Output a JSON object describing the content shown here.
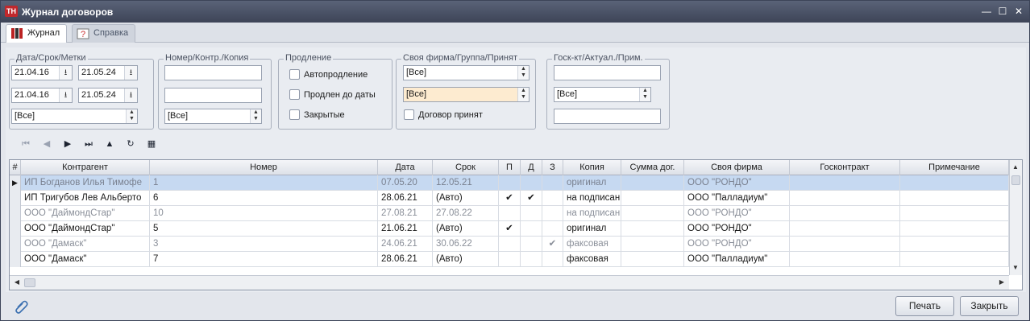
{
  "window": {
    "title": "Журнал договоров",
    "app_icon": "ТН",
    "minimize": "—",
    "maximize": "☐",
    "close": "✕"
  },
  "tabs": [
    {
      "label": "Журнал",
      "icon": "journal-icon"
    },
    {
      "label": "Справка",
      "icon": "help-icon"
    }
  ],
  "filters": {
    "dates": {
      "title": "Дата/Срок/Метки",
      "date_from1": "21.04.16",
      "date_to1": "21.05.24",
      "date_from2": "21.04.16",
      "date_to2": "21.05.24",
      "marks": "[Все]"
    },
    "number": {
      "title": "Номер/Контр./Копия",
      "number": "",
      "contractor": "",
      "copy": "[Все]"
    },
    "renewal": {
      "title": "Продление",
      "auto": "Автопродление",
      "extended": "Продлен до даты",
      "closed": "Закрытые"
    },
    "company": {
      "title": "Своя фирма/Группа/Принят",
      "firm": "[Все]",
      "group": "[Все]",
      "accepted": "Договор принят"
    },
    "state": {
      "title": "Госк-кт/Актуал./Прим.",
      "gos": "",
      "actual": "[Все]",
      "note": ""
    }
  },
  "grid": {
    "columns": [
      "#",
      "Контрагент",
      "Номер",
      "Дата",
      "Срок",
      "П",
      "Д",
      "З",
      "Копия",
      "Сумма дог.",
      "Своя фирма",
      "Госконтракт",
      "Примечание"
    ],
    "rows": [
      {
        "contractor": "ИП Богданов Илья Тимофе",
        "number": "1",
        "date": "07.05.20",
        "term": "12.05.21",
        "p": "",
        "d": "",
        "z": "",
        "copy": "оригинал",
        "sum": "",
        "firm": "ООО \"РОНДО\"",
        "gos": "",
        "note": ""
      },
      {
        "contractor": "ИП Тригубов Лев Альберто",
        "number": "6",
        "date": "28.06.21",
        "term": "(Авто)",
        "p": "✔",
        "d": "✔",
        "z": "",
        "copy": "на подписан",
        "sum": "",
        "firm": "ООО \"Палладиум\"",
        "gos": "",
        "note": ""
      },
      {
        "contractor": "ООО \"ДаймондСтар\"",
        "number": "10",
        "date": "27.08.21",
        "term": "27.08.22",
        "p": "",
        "d": "",
        "z": "",
        "copy": "на подписан",
        "sum": "",
        "firm": "ООО \"РОНДО\"",
        "gos": "",
        "note": ""
      },
      {
        "contractor": "ООО \"ДаймондСтар\"",
        "number": "5",
        "date": "21.06.21",
        "term": "(Авто)",
        "p": "✔",
        "d": "",
        "z": "",
        "copy": "оригинал",
        "sum": "",
        "firm": "ООО \"РОНДО\"",
        "gos": "",
        "note": ""
      },
      {
        "contractor": "ООО \"Дамаск\"",
        "number": "3",
        "date": "24.06.21",
        "term": "30.06.22",
        "p": "",
        "d": "",
        "z": "✔",
        "copy": "факсовая",
        "sum": "",
        "firm": "ООО \"РОНДО\"",
        "gos": "",
        "note": ""
      },
      {
        "contractor": "ООО \"Дамаск\"",
        "number": "7",
        "date": "28.06.21",
        "term": "(Авто)",
        "p": "",
        "d": "",
        "z": "",
        "copy": "факсовая",
        "sum": "",
        "firm": "ООО \"Палладиум\"",
        "gos": "",
        "note": ""
      }
    ]
  },
  "footer": {
    "print": "Печать",
    "close": "Закрыть"
  },
  "colors": {
    "titlebar": "#4a5266",
    "selection": "#c6d9f1",
    "highlight": "#fdebd0"
  }
}
